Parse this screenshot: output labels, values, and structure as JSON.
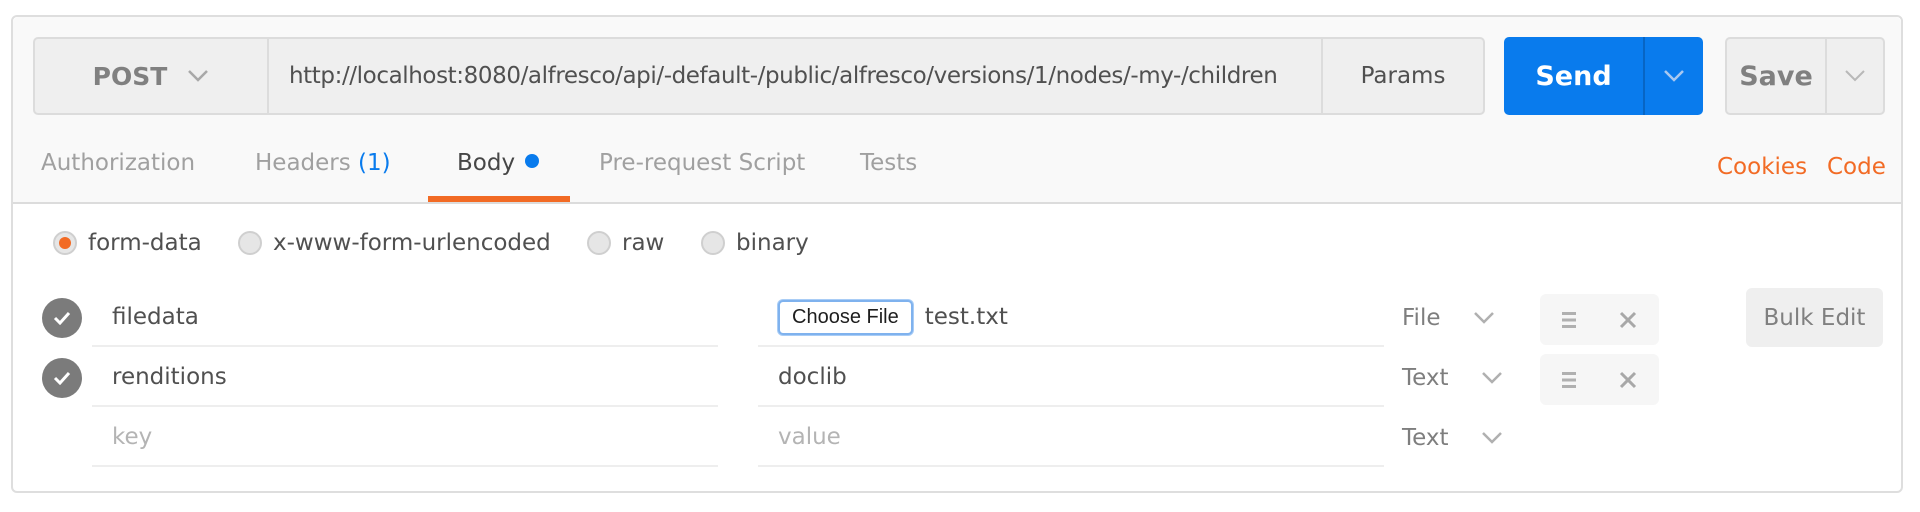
{
  "request": {
    "method": "POST",
    "url": "http://localhost:8080/alfresco/api/-default-/public/alfresco/versions/1/nodes/-my-/children",
    "params_label": "Params",
    "send_label": "Send",
    "save_label": "Save"
  },
  "tabs": [
    {
      "label": "Authorization"
    },
    {
      "label": "Headers",
      "count": "(1)"
    },
    {
      "label": "Body",
      "active": true
    },
    {
      "label": "Pre-request Script"
    },
    {
      "label": "Tests"
    }
  ],
  "links": {
    "cookies": "Cookies",
    "code": "Code"
  },
  "body_modes": [
    {
      "label": "form-data",
      "selected": true
    },
    {
      "label": "x-www-form-urlencoded",
      "selected": false
    },
    {
      "label": "raw",
      "selected": false
    },
    {
      "label": "binary",
      "selected": false
    }
  ],
  "form_rows": [
    {
      "enabled": true,
      "key": "filedata",
      "value_button": "Choose File",
      "value": "test.txt",
      "type": "File"
    },
    {
      "enabled": true,
      "key": "renditions",
      "value": "doclib",
      "type": "Text"
    },
    {
      "key_placeholder": "key",
      "value_placeholder": "value",
      "type": "Text"
    }
  ],
  "bulk_edit_label": "Bulk Edit",
  "colors": {
    "accent": "#f26b25",
    "primary": "#097bed"
  }
}
